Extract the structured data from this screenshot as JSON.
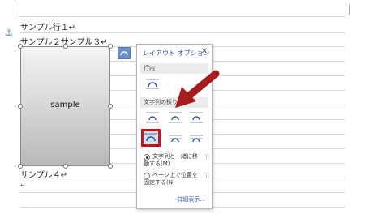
{
  "document": {
    "line1": "サンプル行１↵",
    "line2": "サンプル２サンプル３↵",
    "line4": "サンプル４↵",
    "line5": "↵",
    "image_label": "sample"
  },
  "panel": {
    "title": "レイアウト オプション",
    "close": "✕",
    "section_inline": "行内",
    "section_wrap": "文字列の折り返し",
    "radio_move_with_text": "文字列と一緒に移動する(M)",
    "radio_fix_position": "ページ上で位置を固定する(N)",
    "info_icon": "ⓘ",
    "detail_link": "詳細表示..."
  },
  "colors": {
    "accent": "#2b579a",
    "highlight": "#c0161c",
    "selected_bg": "#cfe0f5"
  }
}
